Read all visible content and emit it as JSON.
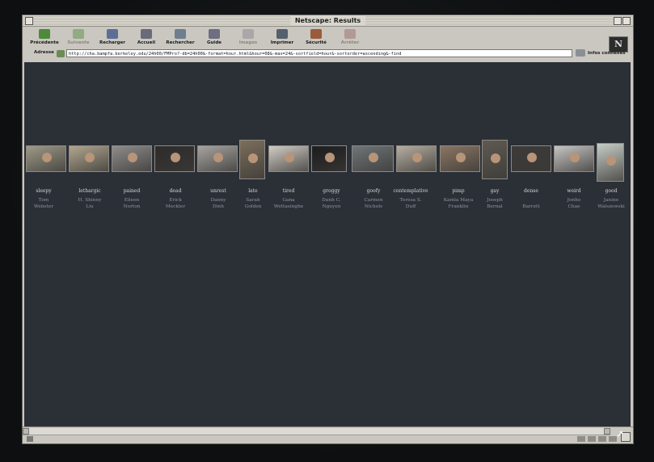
{
  "window": {
    "title": "Netscape: Results"
  },
  "toolbar": {
    "buttons": [
      {
        "label": "Précédente",
        "icon": "back-icon",
        "enabled": true,
        "color": "#4e8a3a"
      },
      {
        "label": "Suivante",
        "icon": "forward-icon",
        "enabled": false,
        "color": "#4e8a3a"
      },
      {
        "label": "Recharger",
        "icon": "reload-icon",
        "enabled": true,
        "color": "#5b6f96"
      },
      {
        "label": "Accueil",
        "icon": "home-icon",
        "enabled": true,
        "color": "#6a6a7a"
      },
      {
        "label": "Rechercher",
        "icon": "search-icon",
        "enabled": true,
        "color": "#6f7d8f"
      },
      {
        "label": "Guide",
        "icon": "guide-icon",
        "enabled": true,
        "color": "#6d6e82"
      },
      {
        "label": "Images",
        "icon": "images-icon",
        "enabled": false,
        "color": "#8a7f8f"
      },
      {
        "label": "Imprimer",
        "icon": "print-icon",
        "enabled": true,
        "color": "#55606e"
      },
      {
        "label": "Sécurité",
        "icon": "security-icon",
        "enabled": true,
        "color": "#9c5a3c"
      },
      {
        "label": "Arrêter",
        "icon": "stop-icon",
        "enabled": false,
        "color": "#9a6262"
      }
    ]
  },
  "location": {
    "label": "Adresse",
    "url": "http://cha.bampfa.berkeley.edu/24h00/FMPro?-db=24h00&-format=hour.html&hour=08&-max=24&-sortfield=hour&-sortorder=ascending&-find",
    "related_label": "Infos connexes"
  },
  "results": [
    {
      "mood": "sleepy",
      "name": [
        "Tom",
        "Webster"
      ],
      "tint": "#9f9a88"
    },
    {
      "mood": "lethargic",
      "name": [
        "H. Shinny",
        "Liu"
      ],
      "tint": "#b2a68f"
    },
    {
      "mood": "pained",
      "name": [
        "Eileen",
        "Norton"
      ],
      "tint": "#8f8d8c"
    },
    {
      "mood": "dead",
      "name": [
        "Erick",
        "Meckler"
      ],
      "tint": "#2e2c2b"
    },
    {
      "mood": "unrest",
      "name": [
        "Danny",
        "Dinh"
      ],
      "tint": "#a7a4a0"
    },
    {
      "mood": "late",
      "name": [
        "Sarah",
        "Golden"
      ],
      "tint": "#7c6e5c"
    },
    {
      "mood": "tired",
      "name": [
        "Gana",
        "Wettasinghe"
      ],
      "tint": "#d1ccc5"
    },
    {
      "mood": "groggy",
      "name": [
        "Danh C.",
        "Nguyen"
      ],
      "tint": "#1d1c1e"
    },
    {
      "mood": "goofy",
      "name": [
        "Carmen",
        "Nichols"
      ],
      "tint": "#6f7578"
    },
    {
      "mood": "contemplative",
      "name": [
        "Teresa S.",
        "Duff"
      ],
      "tint": "#b6aea2"
    },
    {
      "mood": "pimp",
      "name": [
        "Kamla Maya",
        "Franklin"
      ],
      "tint": "#8a7563"
    },
    {
      "mood": "gay",
      "name": [
        "Joseph",
        "Bernal"
      ],
      "tint": "#5f5a52"
    },
    {
      "mood": "dense",
      "name": [
        "",
        "Barrett"
      ],
      "tint": "#3d3b3a"
    },
    {
      "mood": "weird",
      "name": [
        "Jonho",
        "Chae"
      ],
      "tint": "#c7c5c4"
    },
    {
      "mood": "good",
      "name": [
        "Janine",
        "Walszewski"
      ],
      "tint": "#c7cdc7"
    }
  ]
}
